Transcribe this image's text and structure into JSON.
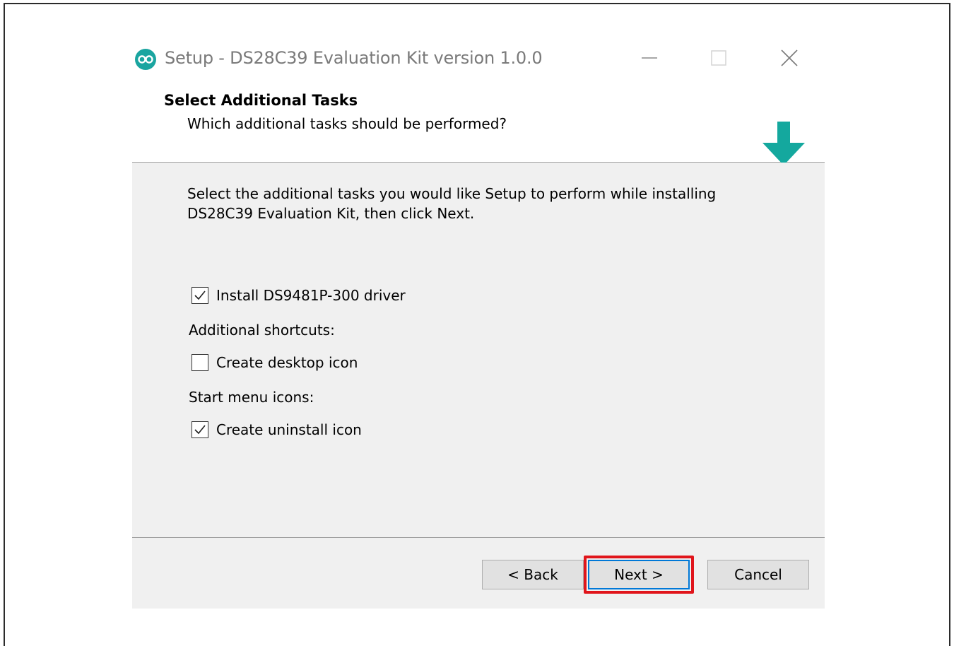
{
  "window": {
    "title": "Setup - DS28C39 Evaluation Kit version 1.0.0"
  },
  "header": {
    "title": "Select Additional Tasks",
    "subtitle": "Which additional tasks should be performed?"
  },
  "content": {
    "intro": "Select the additional tasks you would like Setup to perform while installing DS28C39 Evaluation Kit, then click Next.",
    "tasks": [
      {
        "label": "Install DS9481P-300 driver",
        "checked": true
      },
      {
        "label": "Create desktop icon",
        "checked": false
      },
      {
        "label": "Create uninstall icon",
        "checked": true
      }
    ],
    "groups": {
      "shortcuts_label": "Additional shortcuts:",
      "start_menu_label": "Start menu icons:"
    }
  },
  "footer": {
    "back_label": "< Back",
    "next_label": "Next >",
    "cancel_label": "Cancel"
  },
  "icons": {
    "app": "maxim-logo-icon",
    "header": "install-drive-icon",
    "minimize": "minimize-icon",
    "maximize": "maximize-icon",
    "close": "close-icon",
    "check": "checkmark-icon"
  },
  "colors": {
    "accent": "#1aa5a0",
    "highlight": "#e0151b",
    "focus": "#0078d7"
  }
}
